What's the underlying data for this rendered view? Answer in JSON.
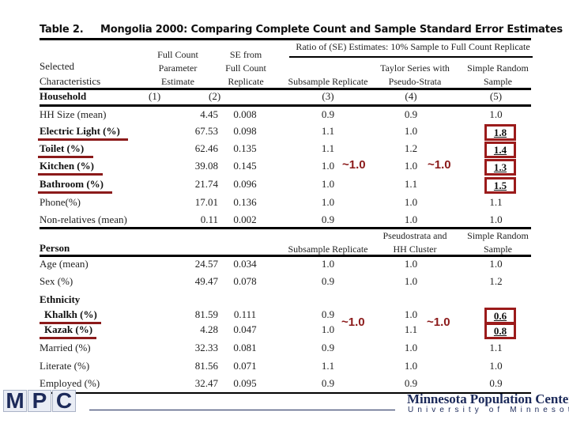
{
  "title": {
    "table_label": "Table 2.",
    "text": "Mongolia 2000:  Comparing Complete Count and Sample Standard Error Estimates"
  },
  "header": {
    "ratio_group": "Ratio of (SE) Estimates: 10% Sample to Full Count Replicate",
    "selected_line1": "Selected",
    "selected_line2": "Characteristics",
    "col1": [
      "Full Count",
      "Parameter",
      "Estimate"
    ],
    "col2": [
      "SE from",
      "Full Count",
      "Replicate"
    ],
    "col3": "Subsample Replicate",
    "col4": [
      "Taylor Series with",
      "Pseudo-Strata"
    ],
    "col5": [
      "Simple Random",
      "Sample"
    ],
    "num1": "(1)",
    "num2": "(2)",
    "num3": "(3)",
    "num4": "(4)",
    "num5": "(5)"
  },
  "household": {
    "section_label": "Household",
    "rows": [
      {
        "label": "HH Size (mean)",
        "est": "4.45",
        "se": "0.008",
        "r3": "0.9",
        "r4": "0.9",
        "r5": "1.0"
      },
      {
        "label": "Electric Light (%)",
        "est": "67.53",
        "se": "0.098",
        "r3": "1.1",
        "r4": "1.0",
        "r5": "1.8"
      },
      {
        "label": "Toilet (%)",
        "est": "62.46",
        "se": "0.135",
        "r3": "1.1",
        "r4": "1.2",
        "r5": "1.4"
      },
      {
        "label": "Kitchen (%)",
        "est": "39.08",
        "se": "0.145",
        "r3": "1.0",
        "r4": "1.0",
        "r5": "1.3"
      },
      {
        "label": "Bathroom (%)",
        "est": "21.74",
        "se": "0.096",
        "r3": "1.0",
        "r4": "1.1",
        "r5": "1.5"
      },
      {
        "label": "Phone(%)",
        "est": "17.01",
        "se": "0.136",
        "r3": "1.0",
        "r4": "1.0",
        "r5": "1.1"
      },
      {
        "label": "Non-relatives (mean)",
        "est": "0.11",
        "se": "0.002",
        "r3": "0.9",
        "r4": "1.0",
        "r5": "1.0"
      }
    ],
    "approx_col3": "~1.0",
    "approx_col4": "~1.0"
  },
  "person": {
    "section_label": "Person",
    "col3": "Subsample Replicate",
    "col4": [
      "Pseudostrata and",
      "HH Cluster"
    ],
    "col5": [
      "Simple Random",
      "Sample"
    ],
    "rows": [
      {
        "label": "Age (mean)",
        "est": "24.57",
        "se": "0.034",
        "r3": "1.0",
        "r4": "1.0",
        "r5": "1.0"
      },
      {
        "label": "Sex (%)",
        "est": "49.47",
        "se": "0.078",
        "r3": "0.9",
        "r4": "1.0",
        "r5": "1.2"
      },
      {
        "label": "Khalkh (%)",
        "est": "81.59",
        "se": "0.111",
        "r3": "0.9",
        "r4": "1.0",
        "r5": "0.6"
      },
      {
        "label": "Kazak (%)",
        "est": "4.28",
        "se": "0.047",
        "r3": "1.0",
        "r4": "1.1",
        "r5": "0.8"
      },
      {
        "label": "Married (%)",
        "est": "32.33",
        "se": "0.081",
        "r3": "0.9",
        "r4": "1.0",
        "r5": "1.1"
      },
      {
        "label": "Literate (%)",
        "est": "81.56",
        "se": "0.071",
        "r3": "1.1",
        "r4": "1.0",
        "r5": "1.0"
      },
      {
        "label": "Employed (%)",
        "est": "32.47",
        "se": "0.095",
        "r3": "0.9",
        "r4": "0.9",
        "r5": "0.9"
      }
    ],
    "ethnicity_label": "Ethnicity",
    "approx_col3": "~1.0",
    "approx_col4": "~1.0"
  },
  "footer": {
    "logo_letters": [
      "M",
      "P",
      "C"
    ],
    "org_name": "Minnesota Population Center",
    "org_sub": "University of Minnesota"
  },
  "colors": {
    "highlight": "#8b1a1a",
    "logo_navy": "#1c2a5a"
  }
}
